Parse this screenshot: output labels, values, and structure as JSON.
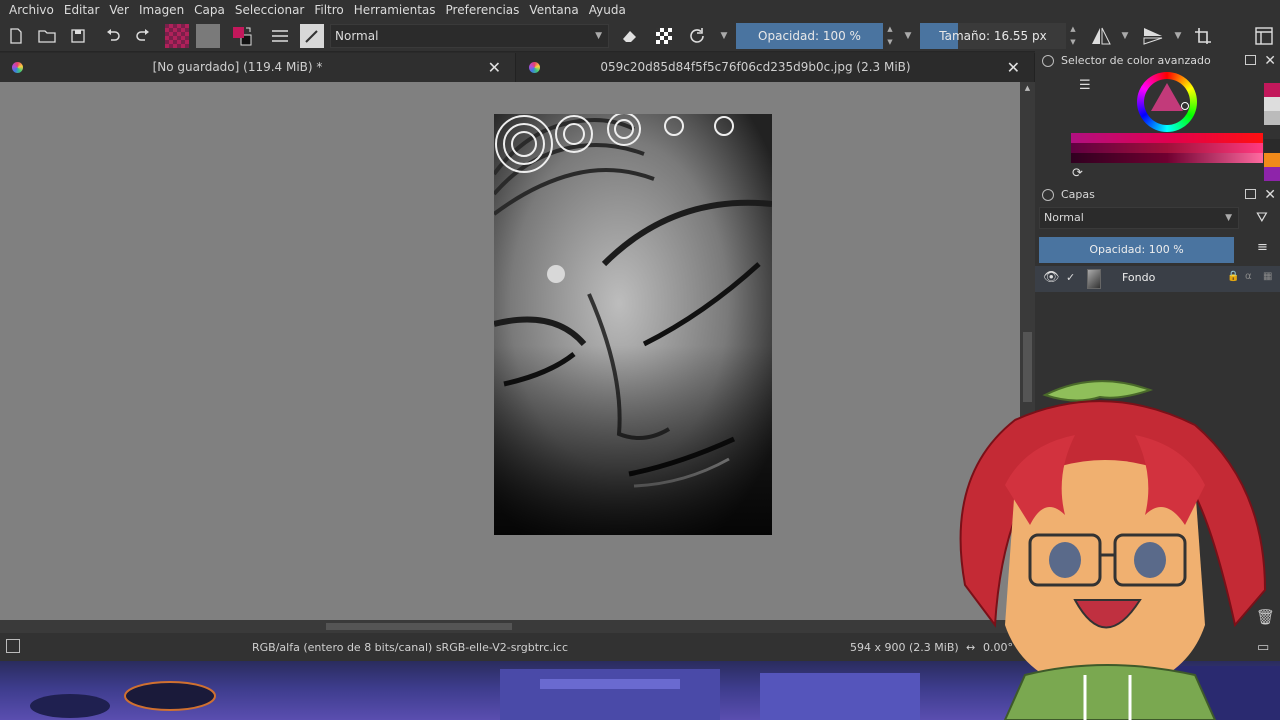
{
  "menu": [
    "Archivo",
    "Editar",
    "Ver",
    "Imagen",
    "Capa",
    "Seleccionar",
    "Filtro",
    "Herramientas",
    "Preferencias",
    "Ventana",
    "Ayuda"
  ],
  "toolbar": {
    "blend_mode": "Normal",
    "opacity_label": "Opacidad: 100 %",
    "size_label": "Tamaño: 16.55 px"
  },
  "tabs": [
    {
      "label": "[No guardado]  (119.4 MiB) *"
    },
    {
      "label": "059c20d85d84f5f5c76f06cd235d9b0c.jpg (2.3 MiB)"
    }
  ],
  "status": {
    "color_space": "RGB/alfa (entero de 8 bits/canal)  sRGB-elle-V2-srgbtrc.icc",
    "image_size": "594 x 900 (2.3 MiB)",
    "rotation": "0.00°"
  },
  "dock": {
    "color_selector_title": "Selector de color avanzado",
    "layers_title": "Capas",
    "layers_blend_mode": "Normal",
    "layer_opacity_label": "Opacidad: 100 %",
    "layer_name": "Fondo"
  },
  "colors": {
    "accent": "#4a74a0",
    "canvas": "#808080",
    "panel": "#323232"
  }
}
